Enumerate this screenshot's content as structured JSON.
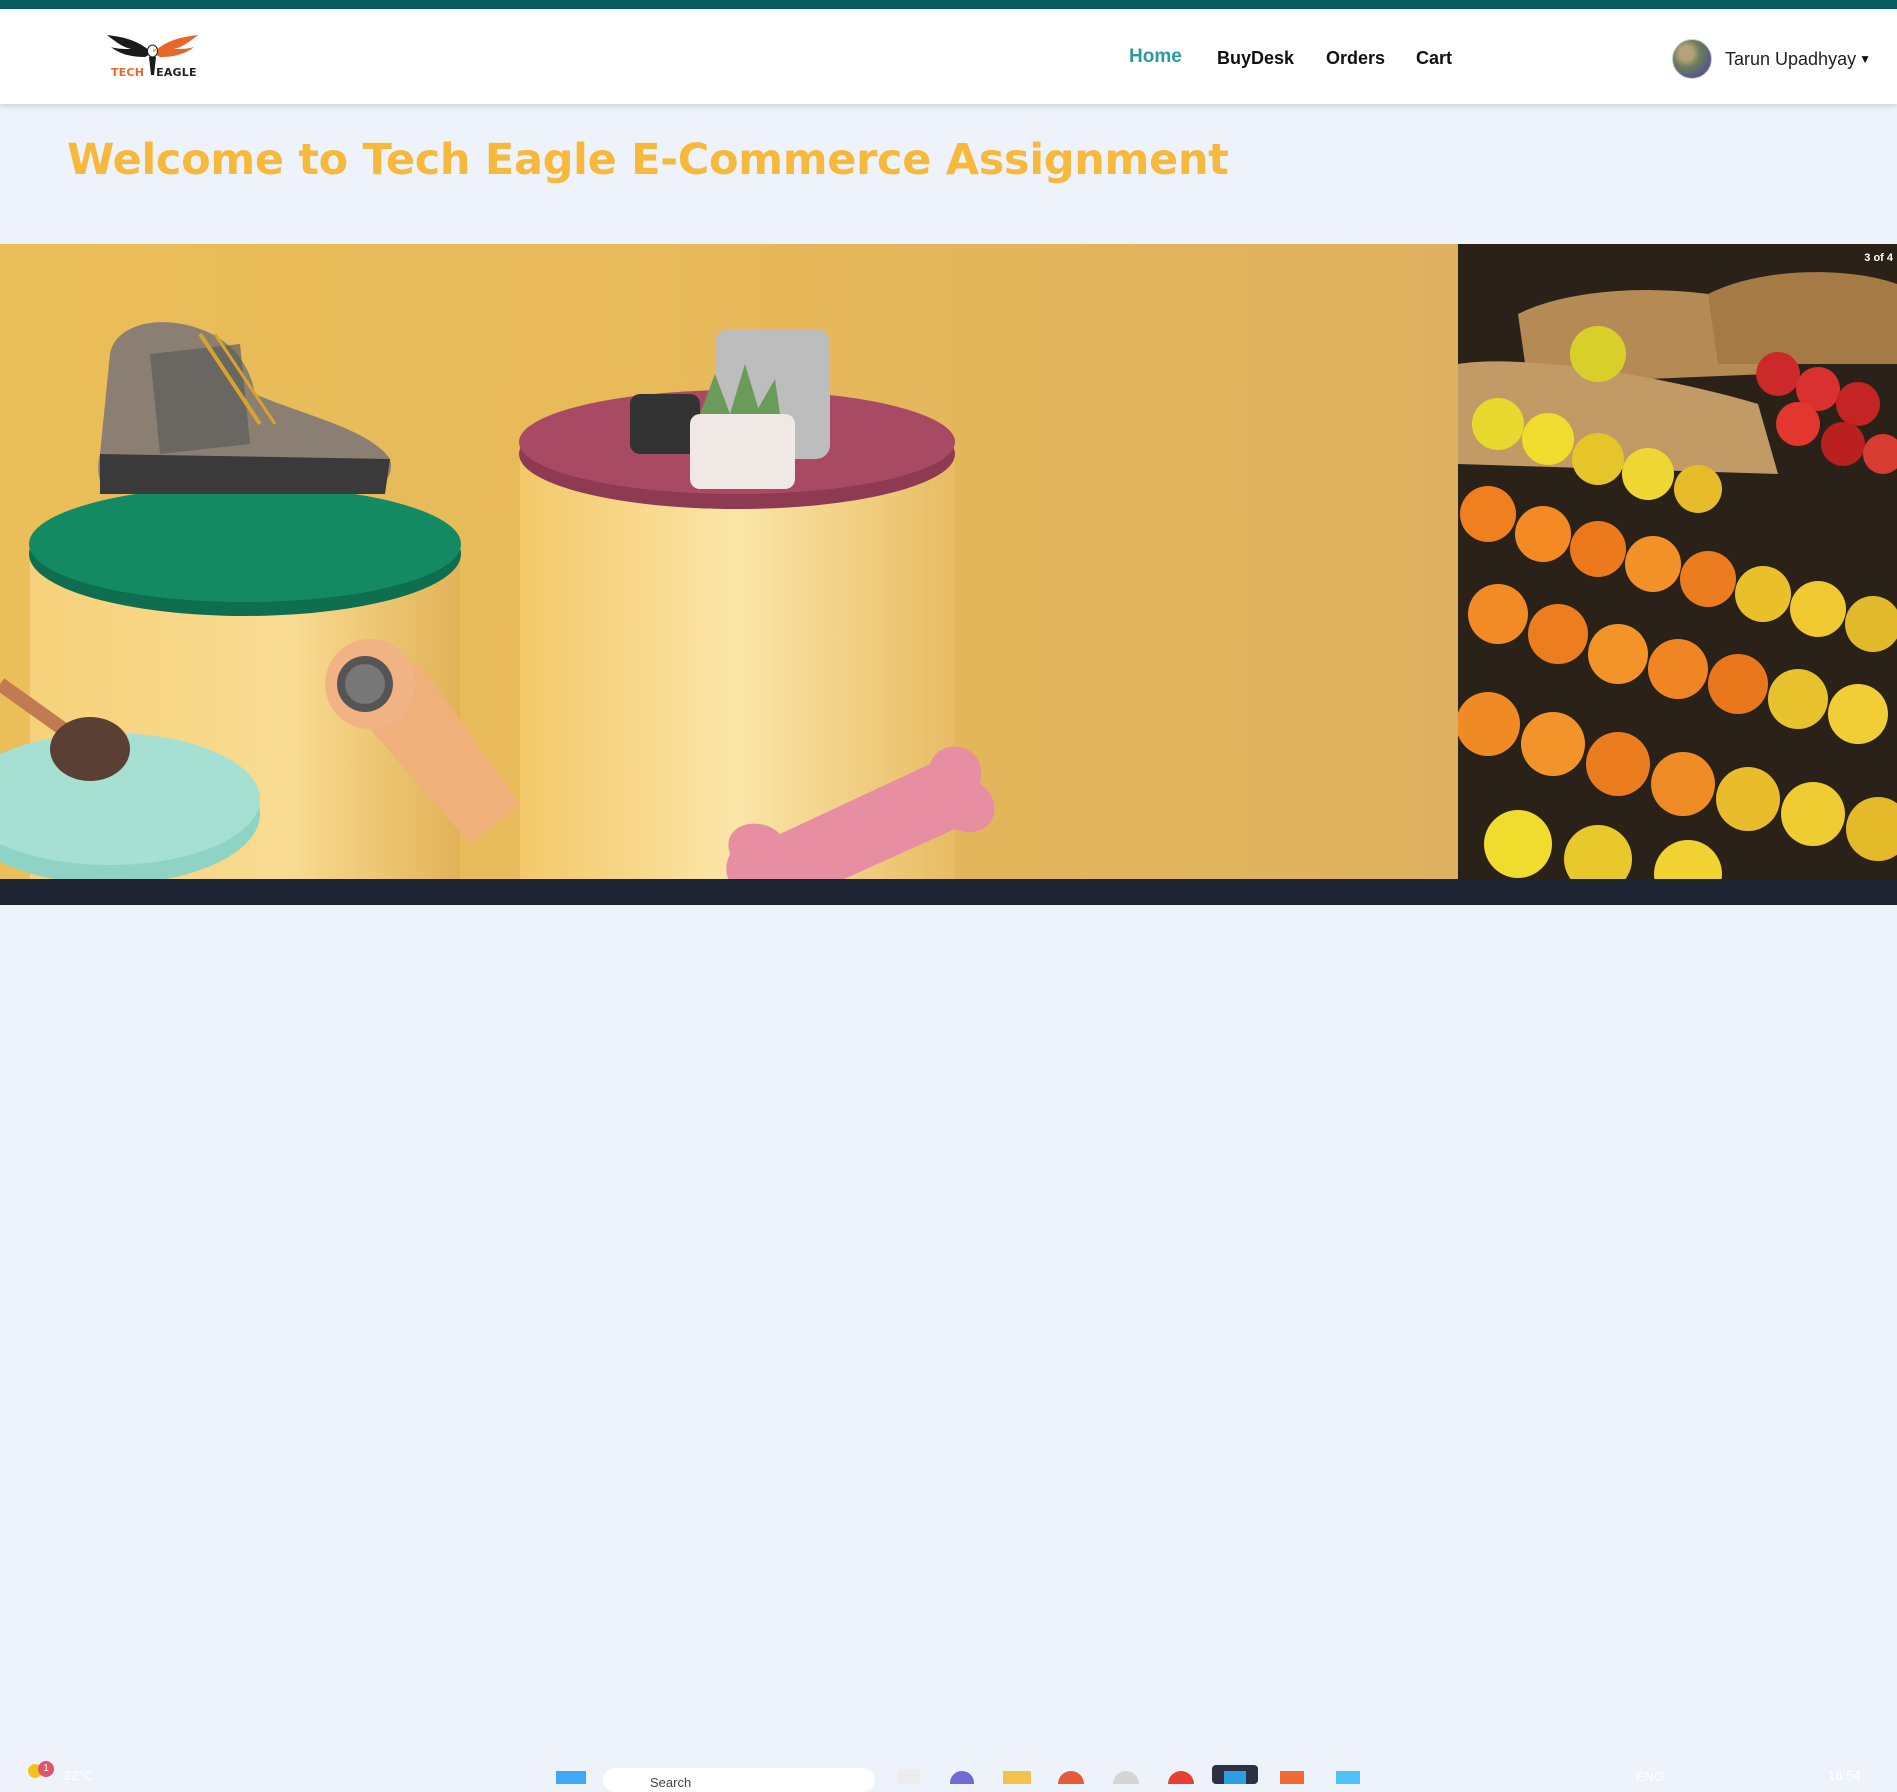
{
  "app": {
    "logo": {
      "text_left": "TECH",
      "text_right": "EAGLE"
    },
    "nav": {
      "items": [
        {
          "label": "Home",
          "active": true
        },
        {
          "label": "BuyDesk",
          "active": false
        },
        {
          "label": "Orders",
          "active": false
        },
        {
          "label": "Cart",
          "active": false
        }
      ]
    },
    "user": {
      "name": "Tarun Upadhyay",
      "caret_icon": "chevron-down-icon"
    },
    "welcome_title": "Welcome to Tech Eagle E-Commerce Assignment",
    "carousel": {
      "counter": "3 of 4"
    }
  },
  "taskbar": {
    "weather": {
      "badge": "1",
      "temp": "22°C"
    },
    "search_placeholder": "Search",
    "language": "ENG",
    "clock": "16:54"
  },
  "colors": {
    "accent": "#2a9d99",
    "welcome": "#f6b93b",
    "topbar": "#0b5b63"
  }
}
